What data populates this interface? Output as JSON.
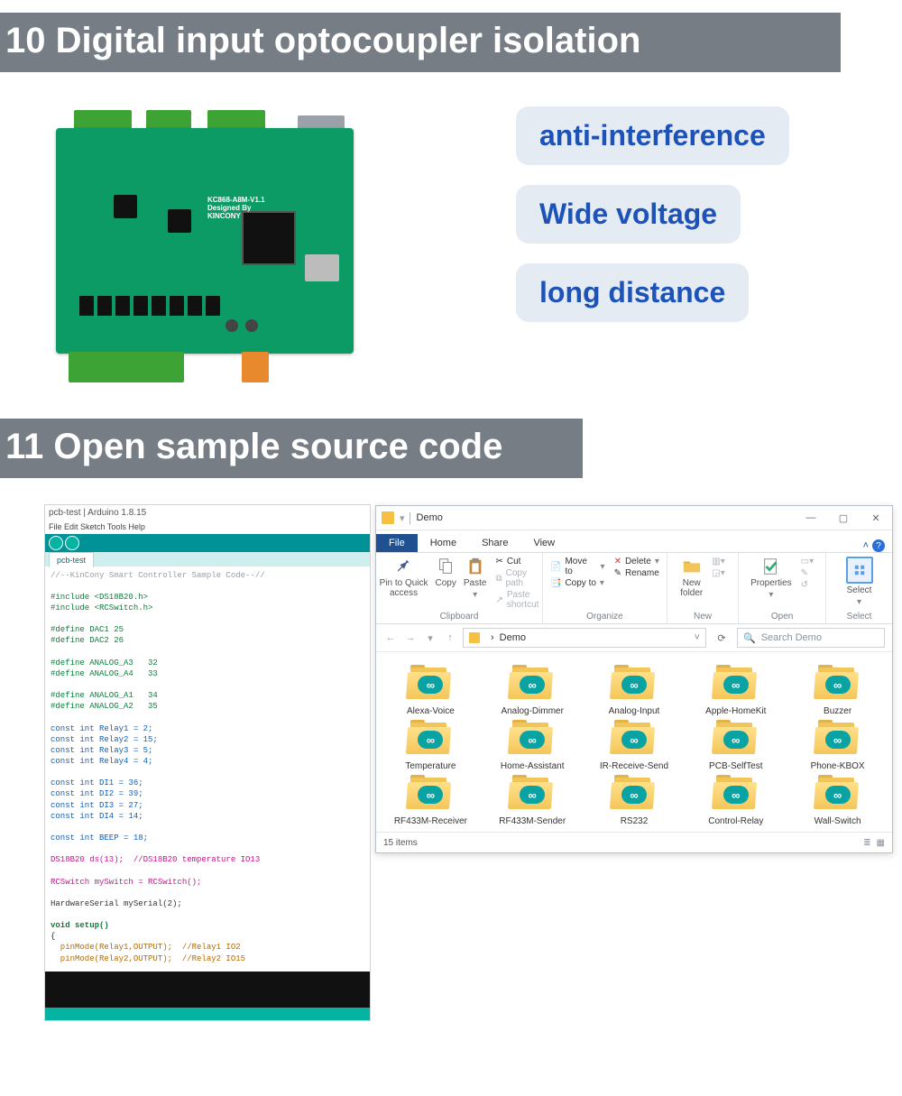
{
  "section10_title": "10 Digital input optocoupler isolation",
  "section11_title": "11 Open sample source code",
  "pcb": {
    "silk1": "KC868-A8M-V1.1",
    "silk2": "Designed By",
    "silk3": "KINCONY"
  },
  "features": [
    "anti-interference",
    "Wide voltage",
    "long distance"
  ],
  "ide": {
    "title": "pcb-test | Arduino 1.8.15",
    "menu": "File  Edit  Sketch  Tools  Help",
    "tab": "pcb-test",
    "code": [
      {
        "cls": "gr",
        "t": "//--KinCony Smart Controller Sample Code--//"
      },
      {
        "cls": "",
        "t": ""
      },
      {
        "cls": "gn",
        "t": "#include <DS18B20.h>"
      },
      {
        "cls": "gn",
        "t": "#include <RCSwitch.h>"
      },
      {
        "cls": "",
        "t": ""
      },
      {
        "cls": "gn",
        "t": "#define DAC1 25"
      },
      {
        "cls": "gn",
        "t": "#define DAC2 26"
      },
      {
        "cls": "",
        "t": ""
      },
      {
        "cls": "gn",
        "t": "#define ANALOG_A3   32"
      },
      {
        "cls": "gn",
        "t": "#define ANALOG_A4   33"
      },
      {
        "cls": "",
        "t": ""
      },
      {
        "cls": "gn",
        "t": "#define ANALOG_A1   34"
      },
      {
        "cls": "gn",
        "t": "#define ANALOG_A2   35"
      },
      {
        "cls": "",
        "t": ""
      },
      {
        "cls": "bl",
        "t": "const int Relay1 = 2;"
      },
      {
        "cls": "bl",
        "t": "const int Relay2 = 15;"
      },
      {
        "cls": "bl",
        "t": "const int Relay3 = 5;"
      },
      {
        "cls": "bl",
        "t": "const int Relay4 = 4;"
      },
      {
        "cls": "",
        "t": ""
      },
      {
        "cls": "bl",
        "t": "const int DI1 = 36;"
      },
      {
        "cls": "bl",
        "t": "const int DI2 = 39;"
      },
      {
        "cls": "bl",
        "t": "const int DI3 = 27;"
      },
      {
        "cls": "bl",
        "t": "const int DI4 = 14;"
      },
      {
        "cls": "",
        "t": ""
      },
      {
        "cls": "bl",
        "t": "const int BEEP = 18;"
      },
      {
        "cls": "",
        "t": ""
      },
      {
        "cls": "pk",
        "t": "DS18B20 ds(13);  //DS18B20 temperature IO13"
      },
      {
        "cls": "",
        "t": ""
      },
      {
        "cls": "pk",
        "t": "RCSwitch mySwitch = RCSwitch();"
      },
      {
        "cls": "",
        "t": ""
      },
      {
        "cls": "",
        "t": "HardwareSerial mySerial(2);"
      },
      {
        "cls": "",
        "t": ""
      },
      {
        "cls": "kw",
        "t": "void setup()"
      },
      {
        "cls": "",
        "t": "{"
      },
      {
        "cls": "or",
        "t": "  pinMode(Relay1,OUTPUT);  //Relay1 IO2"
      },
      {
        "cls": "or",
        "t": "  pinMode(Relay2,OUTPUT);  //Relay2 IO15"
      }
    ]
  },
  "explorer": {
    "window_title": "Demo",
    "tabs": {
      "file": "File",
      "home": "Home",
      "share": "Share",
      "view": "View"
    },
    "ribbon": {
      "clipboard": {
        "name": "Clipboard",
        "pin": "Pin to Quick\naccess",
        "copy": "Copy",
        "paste": "Paste",
        "cut": "Cut",
        "copypath": "Copy path",
        "shortcut": "Paste shortcut"
      },
      "organize": {
        "name": "Organize",
        "moveto": "Move to",
        "copyto": "Copy to",
        "delete": "Delete",
        "rename": "Rename"
      },
      "new": {
        "name": "New",
        "newfolder": "New\nfolder"
      },
      "open": {
        "name": "Open",
        "properties": "Properties"
      },
      "select": {
        "name": "Select",
        "all": "Select"
      }
    },
    "address": {
      "label": "Demo",
      "search_placeholder": "Search Demo"
    },
    "folders": [
      "Alexa-Voice",
      "Analog-Dimmer",
      "Analog-Input",
      "Apple-HomeKit",
      "Buzzer",
      "Temperature",
      "Home-Assistant",
      "IR-Receive-Send",
      "PCB-SelfTest",
      "Phone-KBOX",
      "RF433M-Receiver",
      "RF433M-Sender",
      "RS232",
      "Control-Relay",
      "Wall-Switch"
    ],
    "status": "15 items"
  }
}
